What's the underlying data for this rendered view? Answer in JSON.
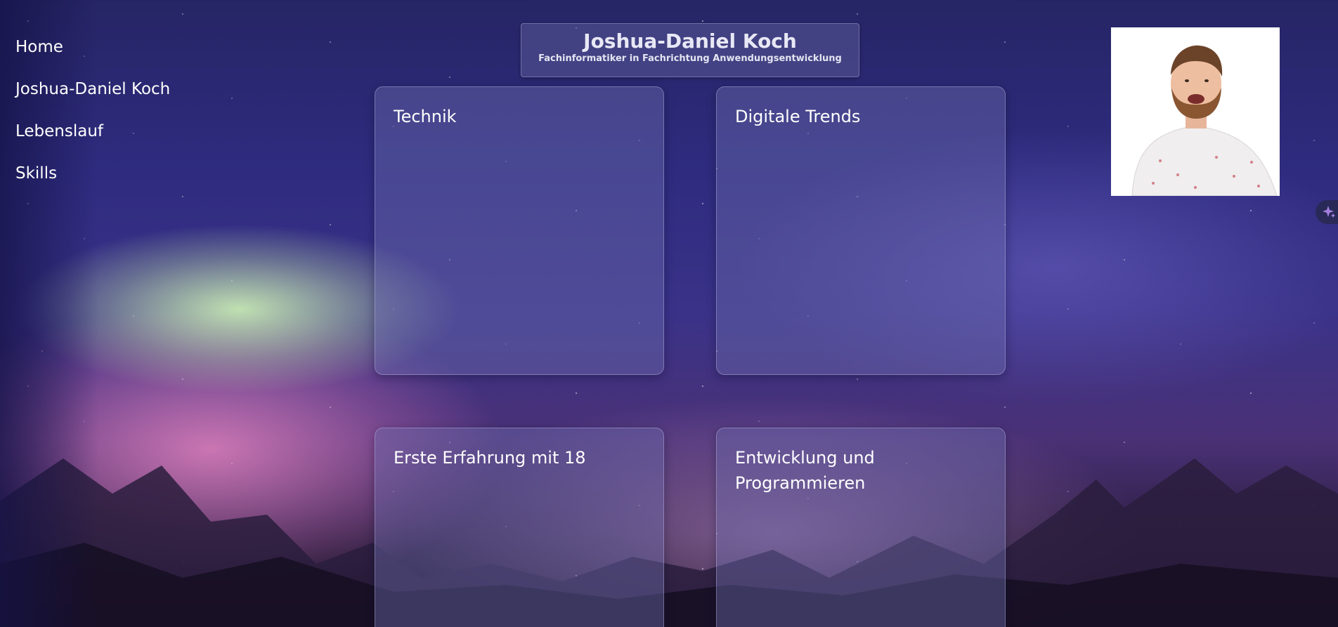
{
  "nav": {
    "items": [
      "Home",
      "Joshua-Daniel Koch",
      "Lebenslauf",
      "Skills"
    ]
  },
  "header": {
    "name": "Joshua-Daniel Koch",
    "subtitle": "Fachinformatiker in Fachrichtung Anwendungsentwicklung"
  },
  "profile": {
    "photo_icon": "portrait-photo"
  },
  "cards": [
    {
      "title": "Technik"
    },
    {
      "title": "Digitale Trends"
    },
    {
      "title": "Erste Erfahrung mit 18"
    },
    {
      "title": "Entwicklung und Programmieren"
    }
  ],
  "side_button": {
    "icon": "sparkle-icon"
  },
  "colors": {
    "sky_top": "#262565",
    "card_bg": "#6e6eaf",
    "accent_sparkle": "#a57fe0"
  }
}
